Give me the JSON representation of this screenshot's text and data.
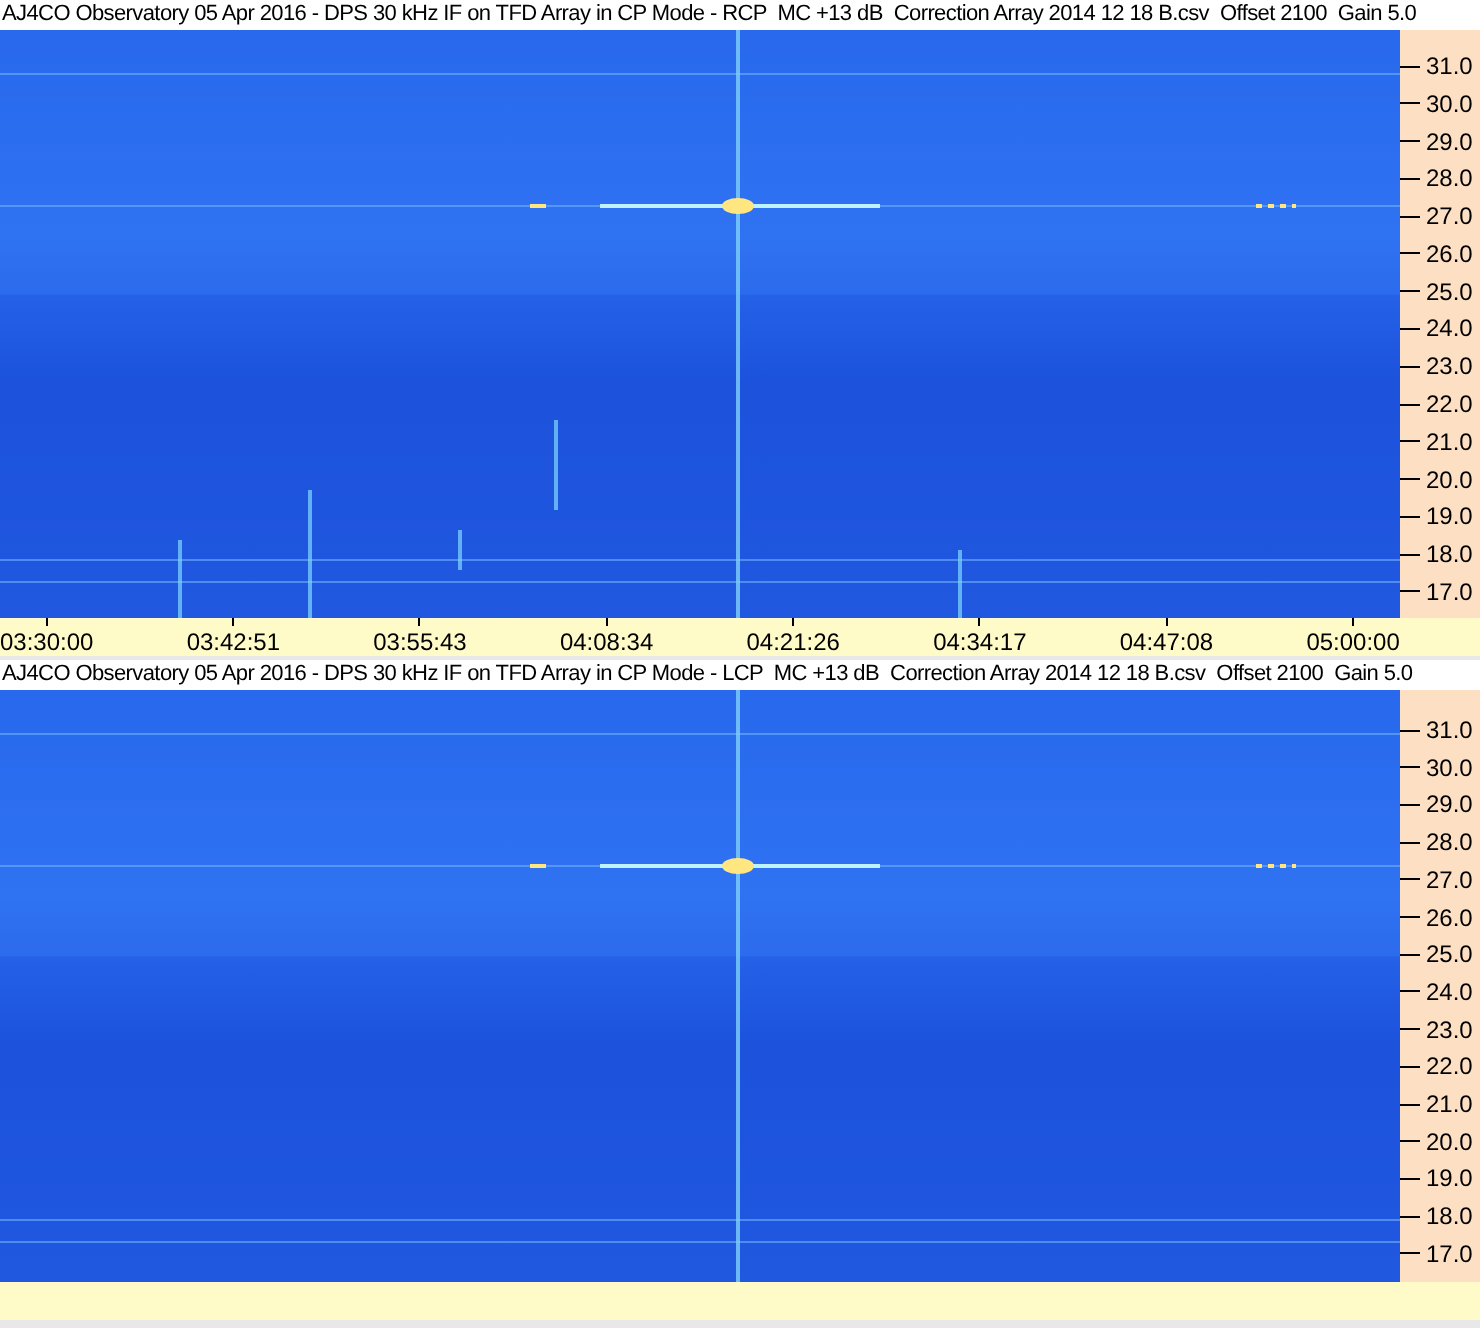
{
  "panels": [
    {
      "title": "AJ4CO Observatory 05 Apr 2016 - DPS 30 kHz IF on TFD Array in CP Mode - RCP  MC +13 dB  Correction Array 2014 12 18 B.csv  Offset 2100  Gain 5.0",
      "y_ticks": [
        "31.0",
        "30.0",
        "29.0",
        "28.0",
        "27.0",
        "26.0",
        "25.0",
        "24.0",
        "23.0",
        "22.0",
        "21.0",
        "20.0",
        "19.0",
        "18.0",
        "17.0"
      ],
      "x_ticks": [
        "03:30:00",
        "03:42:51",
        "03:55:43",
        "04:08:34",
        "04:21:26",
        "04:34:17",
        "04:47:08",
        "05:00:00"
      ]
    },
    {
      "title": "AJ4CO Observatory 05 Apr 2016 - DPS 30 kHz IF on TFD Array in CP Mode - LCP  MC +13 dB  Correction Array 2014 12 18 B.csv  Offset 2100  Gain 5.0",
      "y_ticks": [
        "31.0",
        "30.0",
        "29.0",
        "28.0",
        "27.0",
        "26.0",
        "25.0",
        "24.0",
        "23.0",
        "22.0",
        "21.0",
        "20.0",
        "19.0",
        "18.0",
        "17.0"
      ]
    }
  ]
}
